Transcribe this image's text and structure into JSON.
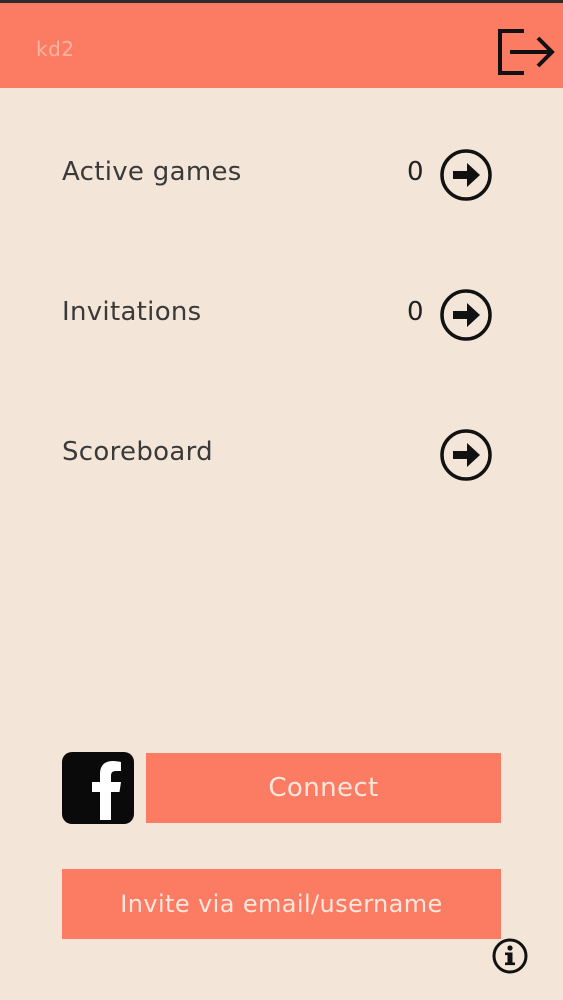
{
  "header": {
    "title": "kd2",
    "logout_icon": "logout-icon",
    "color": "#fb7c62"
  },
  "menu": [
    {
      "label": "Active games",
      "count": "0",
      "icon": "arrow-right-circle-icon"
    },
    {
      "label": "Invitations",
      "count": "0",
      "icon": "arrow-right-circle-icon"
    },
    {
      "label": "Scoreboard",
      "count": "",
      "icon": "arrow-right-circle-icon"
    }
  ],
  "social": {
    "facebook_icon": "facebook-icon",
    "connect_label": "Connect"
  },
  "invite": {
    "label": "Invite via email/username"
  },
  "footer": {
    "info_icon": "info-icon"
  },
  "colors": {
    "background": "#f3e5d8",
    "accent": "#fb7c62",
    "button_text": "#fde6dd"
  }
}
